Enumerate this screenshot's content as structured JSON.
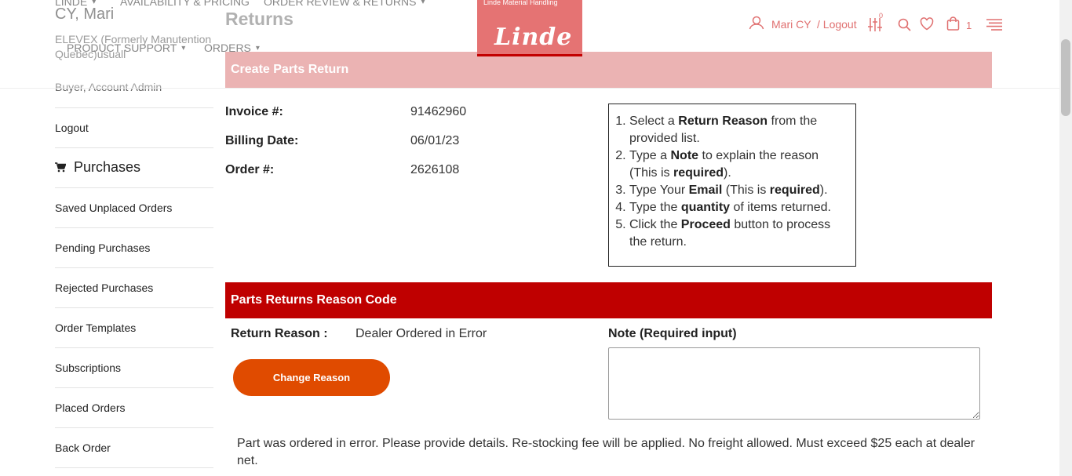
{
  "header": {
    "nav": [
      "LINDE",
      "AVAILABILITY & PRICING",
      "ORDER REVIEW & RETURNS",
      "PRODUCT SUPPORT",
      "ORDERS"
    ],
    "logo_subtitle": "Linde Material Handling",
    "logo_text": "Linde",
    "user_link": "Mari CY",
    "logout_link": "/ Logout",
    "filter_badge": "0",
    "cart_count": "1"
  },
  "sidebar": {
    "user_name": "CY, Mari",
    "company": "ELEVEX (Formerly Manutention Quebec)usuall",
    "role": "Buyer, Account Admin",
    "logout": "Logout",
    "purchases_heading": "Purchases",
    "items": [
      "Saved Unplaced Orders",
      "Pending Purchases",
      "Rejected Purchases",
      "Order Templates",
      "Subscriptions",
      "Placed Orders",
      "Back Order"
    ]
  },
  "main": {
    "page_title": "Returns",
    "create_bar": "Create Parts Return",
    "invoice_label": "Invoice #:",
    "invoice_value": "91462960",
    "billing_label": "Billing Date:",
    "billing_value": "06/01/23",
    "order_label": "Order #:",
    "order_value": "2626108",
    "reason_bar": "Parts Returns Reason Code",
    "return_reason_label": "Return Reason :",
    "return_reason_value": "Dealer Ordered in Error",
    "change_reason_button": "Change Reason",
    "note_label": "Note (Required input)",
    "note_value": "",
    "reason_description": "Part was ordered in error. Please provide details. Re-stocking fee will be applied. No freight allowed. Must exceed $25 each at dealer net."
  },
  "instructions": [
    {
      "pre": "Select a ",
      "bold": "Return Reason",
      "post": " from the provided list."
    },
    {
      "pre": "Type a ",
      "bold": "Note",
      "post": " to explain the reason (This is ",
      "bold2": "required",
      "post2": ")."
    },
    {
      "pre": "Type Your ",
      "bold": "Email",
      "post": " (This is ",
      "bold2": "required",
      "post2": ")."
    },
    {
      "pre": "Type the ",
      "bold": "quantity",
      "post": " of items returned."
    },
    {
      "pre": "Click the ",
      "bold": "Proceed",
      "post": " button to process the return."
    }
  ],
  "colors": {
    "create_bar": "#e08a8a",
    "reason_bar": "#bf0000",
    "change_button": "#e04b00",
    "header_accent": "#e07070"
  },
  "icons": [
    "user-icon",
    "filter-sliders-icon",
    "search-icon",
    "heart-icon",
    "cart-icon",
    "menu-icon",
    "shopping-cart-icon"
  ]
}
